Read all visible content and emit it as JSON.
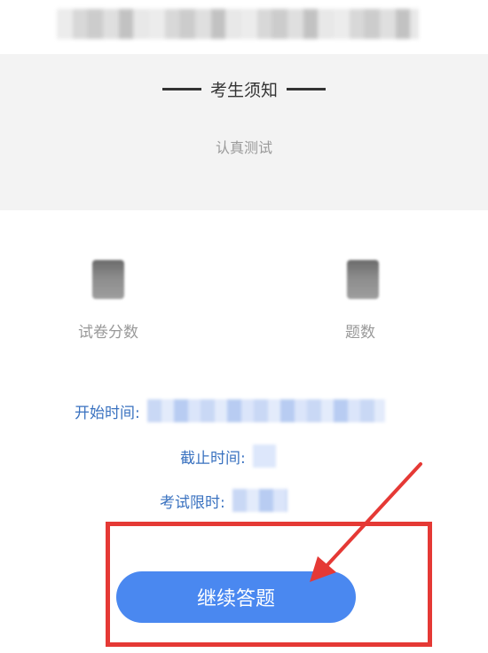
{
  "header": {
    "title_blurred": ""
  },
  "notice": {
    "title": "考生须知",
    "subtitle": "认真测试"
  },
  "stats": {
    "score_label": "试卷分数",
    "questions_label": "题数"
  },
  "info": {
    "start_time_label": "开始时间:",
    "end_time_label": "截止时间:",
    "time_limit_label": "考试限时:"
  },
  "actions": {
    "continue_label": "继续答题"
  },
  "colors": {
    "accent": "#4a88f0",
    "label_blue": "#3a72c0",
    "highlight_red": "#e53935",
    "panel_bg": "#f3f3f3"
  },
  "icons": {
    "stat_left": "score-icon",
    "stat_right": "questions-icon",
    "annotation": "arrow-icon"
  }
}
